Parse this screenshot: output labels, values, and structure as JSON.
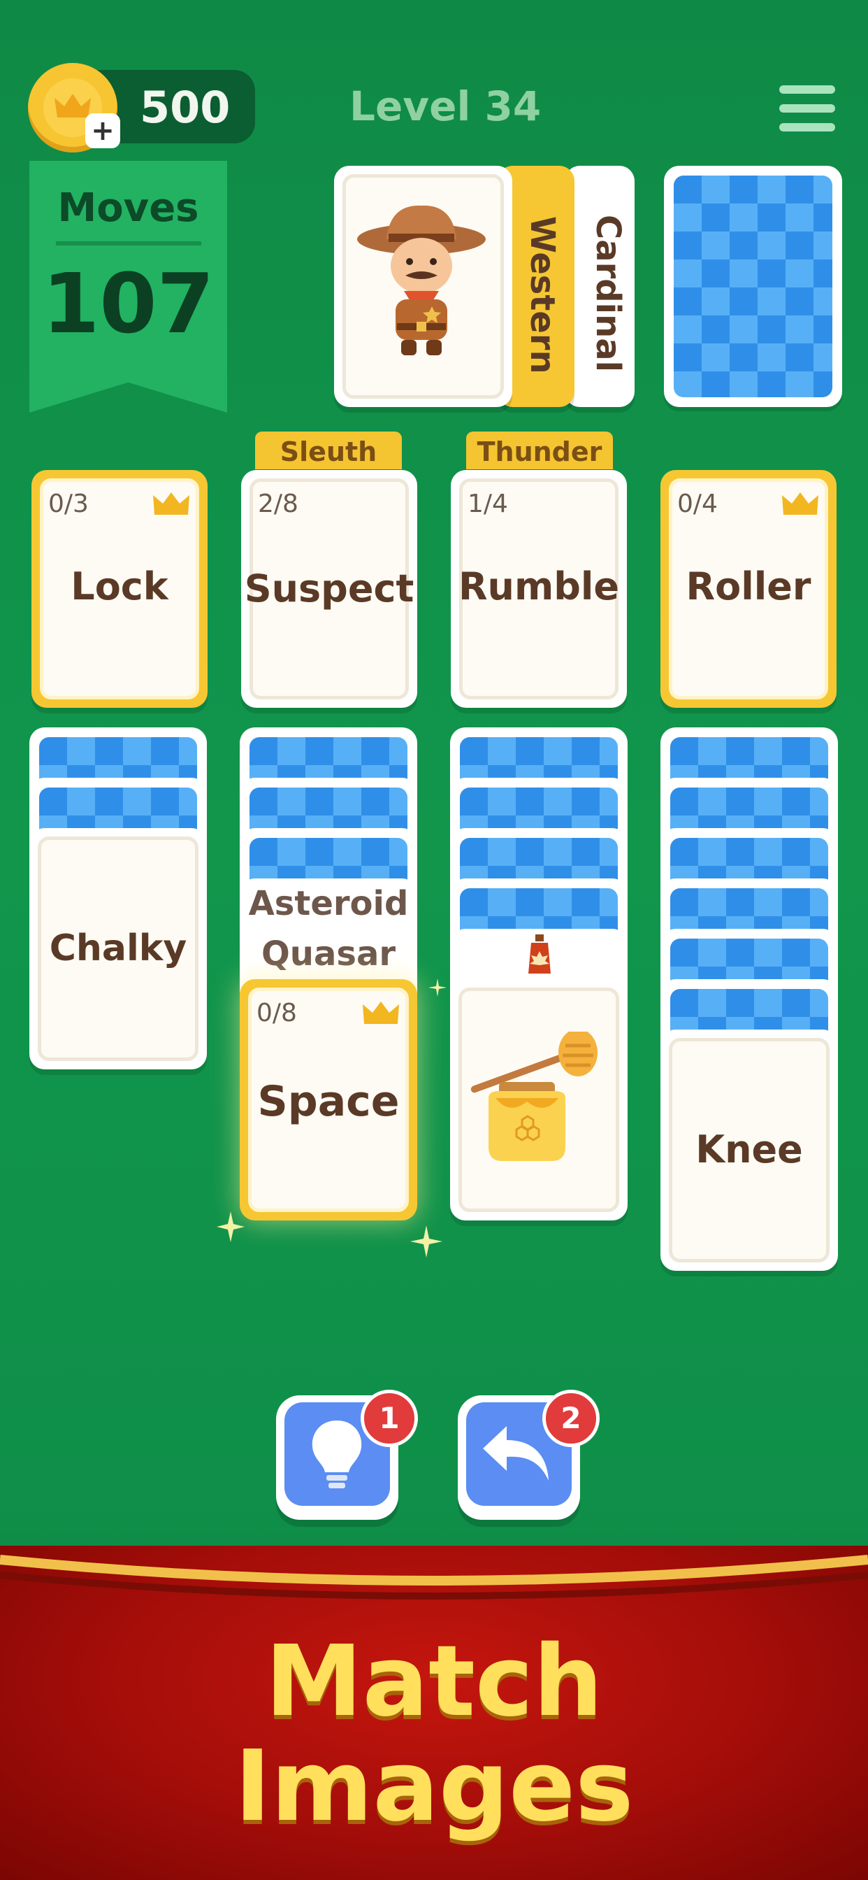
{
  "header": {
    "coins": "500",
    "coin_plus": "+",
    "level": "Level 34"
  },
  "moves": {
    "label": "Moves",
    "value": "107"
  },
  "deck": {
    "stack_labels": [
      "Western",
      "Cardinal"
    ],
    "face_image": "cowboy-character"
  },
  "foundations": [
    {
      "count": "0/3",
      "word": "Lock",
      "gold": true,
      "crown": true
    },
    {
      "tag": "Sleuth",
      "count": "2/8",
      "word": "Suspect",
      "gold": false
    },
    {
      "tag": "Thunder",
      "count": "1/4",
      "word": "Rumble",
      "gold": false
    },
    {
      "count": "0/4",
      "word": "Roller",
      "gold": true,
      "crown": true
    }
  ],
  "columns": {
    "c1": {
      "face_word": "Chalky"
    },
    "c2": {
      "stacked_words": [
        "Asteroid",
        "Quasar"
      ],
      "top_count": "0/8",
      "top_word": "Space"
    },
    "c3": {
      "stacked_icon": "maple-syrup-icon",
      "top_image": "honey-jar"
    },
    "c4": {
      "face_word": "Knee"
    }
  },
  "controls": {
    "hint_badge": "1",
    "undo_badge": "2"
  },
  "banner": {
    "line1": "Match",
    "line2": "Images"
  },
  "colors": {
    "felt": "#11964c",
    "gold": "#f6c733",
    "card_back": "#2f8fe8",
    "banner": "#a30d09",
    "banner_text": "#ffdf5c"
  }
}
